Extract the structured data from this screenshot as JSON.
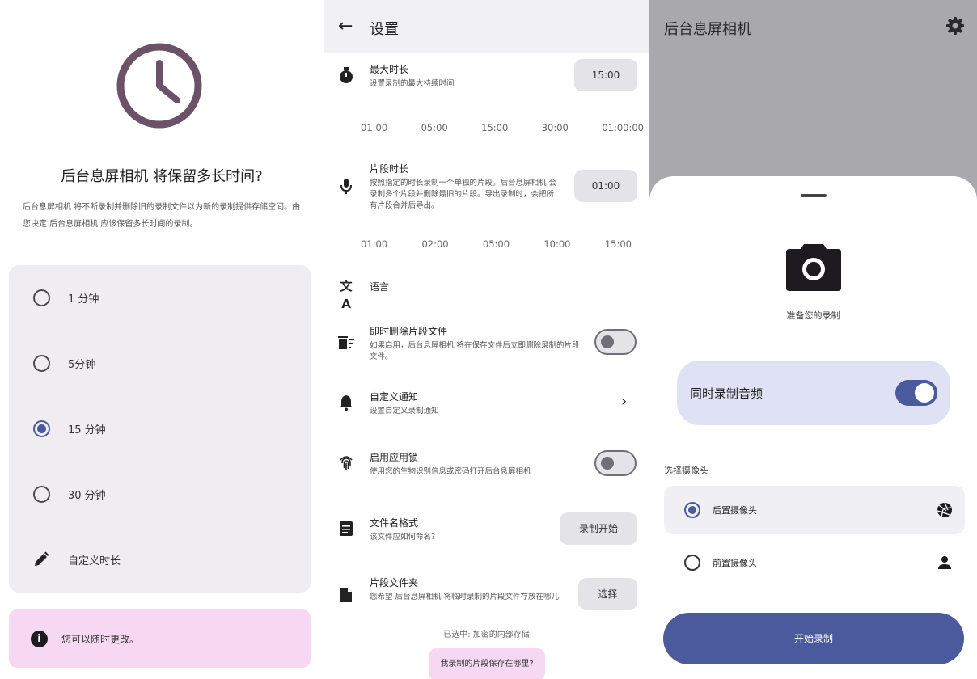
{
  "panel1": {
    "title": "后台息屏相机 将保留多长时间?",
    "description": "后台息屏相机 将不断录制并删除旧的录制文件以为新的录制提供存储空间。由您决定 后台息屏相机 应该保留多长时间的录制。",
    "options": [
      {
        "label": "1 分钟",
        "selected": false
      },
      {
        "label": "5分钟",
        "selected": false
      },
      {
        "label": "15 分钟",
        "selected": true
      },
      {
        "label": "30 分钟",
        "selected": false
      }
    ],
    "custom_label": "自定义时长",
    "note": "您可以随时更改。"
  },
  "panel2": {
    "title": "设置",
    "max_duration": {
      "title": "最大时长",
      "subtitle": "设置录制的最大持续时间",
      "value": "15:00",
      "ticks": [
        "01:00",
        "05:00",
        "15:00",
        "30:00",
        "01:00:00"
      ]
    },
    "segment": {
      "title": "片段时长",
      "subtitle": "按照指定的时长录制一个单独的片段。后台息屏相机 会录制多个片段并删除最旧的片段。导出录制时，会把所有片段合并后导出。",
      "value": "01:00",
      "ticks": [
        "01:00",
        "02:00",
        "05:00",
        "10:00",
        "15:00"
      ]
    },
    "language": {
      "title": "语言"
    },
    "instant_delete": {
      "title": "即时删除片段文件",
      "subtitle": "如果启用，后台息屏相机 将在保存文件后立即删除录制的片段文件。",
      "enabled": false
    },
    "custom_notification": {
      "title": "自定义通知",
      "subtitle": "设置自定义录制通知"
    },
    "app_lock": {
      "title": "启用应用锁",
      "subtitle": "使用您的生物识别信息或密码打开后台息屏相机",
      "enabled": false
    },
    "filename": {
      "title": "文件名格式",
      "subtitle": "该文件应如何命名?",
      "value": "录制开始"
    },
    "folder": {
      "title": "片段文件夹",
      "subtitle": "您希望 后台息屏相机 将临时录制的片段文件存放在哪儿",
      "button": "选择",
      "selected_note": "已选中: 加密的内部存储",
      "help": "我录制的片段保存在哪里?"
    }
  },
  "panel3": {
    "title": "后台息屏相机",
    "ready": "准备您的录制",
    "audio_label": "同时录制音频",
    "audio_enabled": true,
    "camera_section": "选择摄像头",
    "cameras": [
      {
        "label": "后置摄像头",
        "selected": true,
        "icon": "aperture-icon"
      },
      {
        "label": "前置摄像头",
        "selected": false,
        "icon": "person-icon"
      }
    ],
    "start_button": "开始录制"
  },
  "colors": {
    "accent": "#4a5a9c",
    "pink": "#f7d8f3",
    "clock": "#6b5268"
  }
}
